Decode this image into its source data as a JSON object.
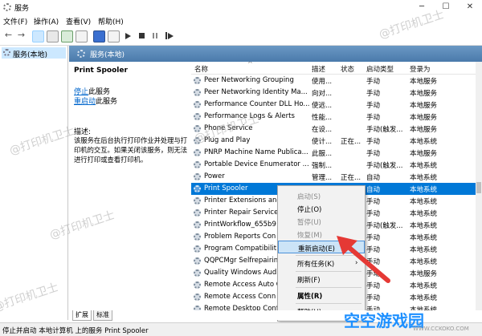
{
  "window": {
    "title": "服务",
    "minimize": "─",
    "maximize": "☐",
    "close": "✕"
  },
  "menu": [
    "文件(F)",
    "操作(A)",
    "查看(V)",
    "帮助(H)"
  ],
  "tree": {
    "item": "服务(本地)"
  },
  "main": {
    "title": "服务(本地)"
  },
  "detail": {
    "service_name": "Print Spooler",
    "stop_link": "停止",
    "stop_suffix": "此服务",
    "restart_link": "重启动",
    "restart_suffix": "此服务",
    "desc_label": "描述:",
    "desc_text": "该服务在后台执行打印作业并处理与打印机的交互。如果关闭该服务，则无法进行打印或查看打印机。"
  },
  "list": {
    "columns": [
      "名称",
      "描述",
      "状态",
      "启动类型",
      "登录为"
    ],
    "rows": [
      [
        "Peer Networking Grouping",
        "使用...",
        "",
        "手动",
        "本地服务"
      ],
      [
        "Peer Networking Identity Ma...",
        "向对...",
        "",
        "手动",
        "本地服务"
      ],
      [
        "Performance Counter DLL Ho...",
        "使远...",
        "",
        "手动",
        "本地服务"
      ],
      [
        "Performance Logs & Alerts",
        "性能...",
        "",
        "手动",
        "本地服务"
      ],
      [
        "Phone Service",
        "在设...",
        "",
        "手动(触发...",
        "本地服务"
      ],
      [
        "Plug and Play",
        "使计...",
        "正在...",
        "手动",
        "本地系统"
      ],
      [
        "PNRP Machine Name Publica...",
        "此服...",
        "",
        "手动",
        "本地服务"
      ],
      [
        "Portable Device Enumerator ...",
        "强制...",
        "",
        "手动(触发...",
        "本地系统"
      ],
      [
        "Power",
        "管理...",
        "正在...",
        "自动",
        "本地系统"
      ],
      [
        "Print Spooler",
        "",
        "",
        "自动",
        "本地系统"
      ],
      [
        "Printer Extensions and",
        "",
        "",
        "手动",
        "本地系统"
      ],
      [
        "Printer Repair Service",
        "",
        "",
        "手动",
        "本地系统"
      ],
      [
        "PrintWorkflow_655b9",
        "",
        "",
        "手动(触发...",
        "本地系统"
      ],
      [
        "Problem Reports Con",
        "",
        "",
        "手动",
        "本地系统"
      ],
      [
        "Program Compatibilit",
        "",
        "",
        "手动",
        "本地系统"
      ],
      [
        "QQPCMgr Selfrepairin",
        "",
        "",
        "手动",
        "本地系统"
      ],
      [
        "Quality Windows Aud",
        "",
        "",
        "手动",
        "本地服务"
      ],
      [
        "Remote Access Auto C",
        "",
        "",
        "手动",
        "本地系统"
      ],
      [
        "Remote Access Conn",
        "",
        "",
        "手动",
        "本地系统"
      ],
      [
        "Remote Desktop Conf",
        "",
        "",
        "手动",
        "本地系统"
      ]
    ]
  },
  "context_menu": {
    "items": [
      {
        "label": "启动(S)",
        "disabled": true
      },
      {
        "label": "停止(O)",
        "disabled": false
      },
      {
        "label": "暂停(U)",
        "disabled": true
      },
      {
        "label": "恢复(M)",
        "disabled": true
      },
      {
        "label": "重新启动(E)",
        "disabled": false,
        "highlight": true
      },
      {
        "label": "所有任务(K)",
        "disabled": false,
        "submenu": true
      },
      {
        "label": "刷新(F)",
        "disabled": false
      },
      {
        "label": "属性(R)",
        "disabled": false,
        "bold": true
      },
      {
        "label": "帮助(H)",
        "disabled": false
      }
    ],
    "submenu_arrow": "›"
  },
  "tabs": [
    "扩展",
    "标准"
  ],
  "status": "停止并启动 本地计算机 上的服务 Print Spooler",
  "watermark": "@打印机卫士",
  "logo": {
    "text": "空空游戏园",
    "url": "WWW.CCKOKO.COM"
  },
  "colors": {
    "selection": "#0078d7",
    "header": "#4a7aab",
    "arrow": "#e53935"
  }
}
